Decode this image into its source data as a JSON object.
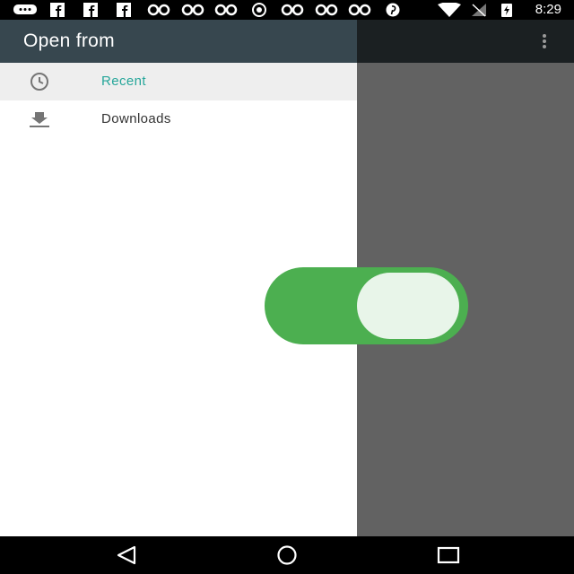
{
  "status_bar": {
    "time": "8:29",
    "icons": [
      "chat-bubble-icon",
      "facebook-icon",
      "facebook-icon",
      "facebook-icon",
      "link-icon",
      "link-icon",
      "link-icon",
      "whatsapp-icon",
      "link-icon",
      "link-icon",
      "link-icon",
      "pinterest-icon",
      "wifi-icon",
      "no-signal-icon",
      "battery-charging-icon"
    ]
  },
  "drawer": {
    "title": "Open from",
    "items": [
      {
        "label": "Recent",
        "icon": "clock-icon",
        "selected": true
      },
      {
        "label": "Downloads",
        "icon": "download-icon",
        "selected": false
      }
    ]
  },
  "toggle": {
    "state": "on",
    "color": "#4caf50"
  },
  "colors": {
    "header": "#37474f",
    "accent": "#26a69a",
    "scrim": "#626262"
  }
}
